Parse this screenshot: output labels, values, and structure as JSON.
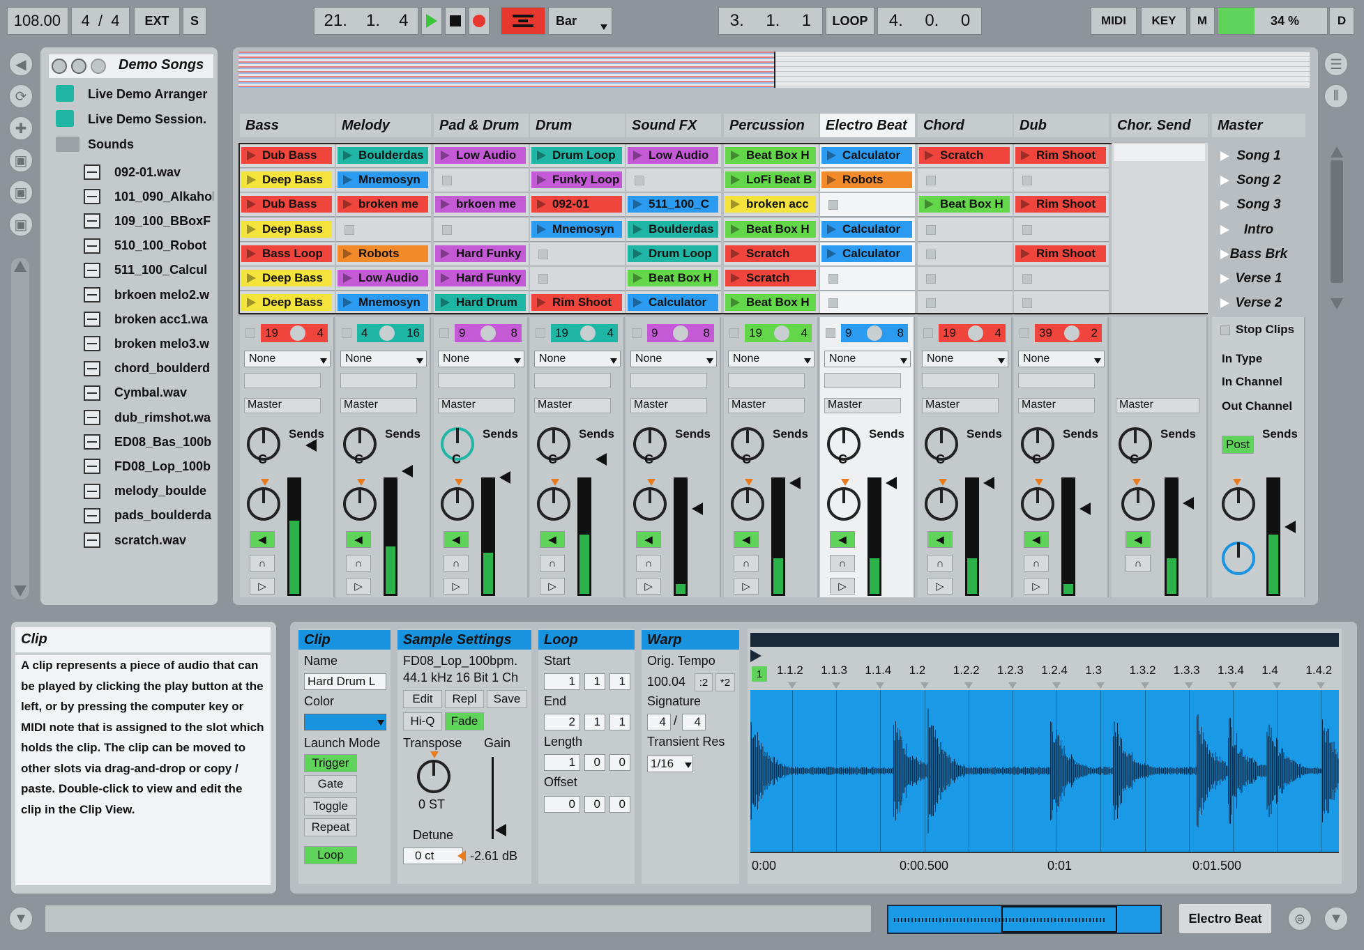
{
  "transport": {
    "tempo": "108.00",
    "sig_num": "4",
    "sig_sep": "/",
    "sig_den": "4",
    "ext": "EXT",
    "s": "S",
    "pos_a": "21.",
    "pos_b": "1.",
    "pos_c": "4",
    "quant": "Bar",
    "loop_start_a": "3.",
    "loop_start_b": "1.",
    "loop_start_c": "1",
    "loop": "LOOP",
    "loop_len_a": "4.",
    "loop_len_b": "0.",
    "loop_len_c": "0",
    "midi": "MIDI",
    "key": "KEY",
    "m": "M",
    "cpu": "34 %",
    "d": "D"
  },
  "browser": {
    "title": "Demo Songs",
    "items": [
      "Live Demo Arranger",
      "Live Demo Session.",
      "Sounds"
    ],
    "files": [
      "092-01.wav",
      "101_090_Alkahol",
      "109_100_BBoxF",
      "510_100_Robot",
      "511_100_Calcul",
      "brkoen melo2.w",
      "broken acc1.wa",
      "broken melo3.w",
      "chord_boulderd",
      "Cymbal.wav",
      "dub_rimshot.wa",
      "ED08_Bas_100b",
      "FD08_Lop_100b",
      "melody_boulde",
      "pads_boulderda",
      "scratch.wav"
    ]
  },
  "tracks": [
    {
      "name": "Bass",
      "clips": [
        [
          "Dub Bass",
          "#f0453d"
        ],
        [
          "Deep Bass",
          "#f4e33a"
        ],
        [
          "Dub Bass",
          "#f0453d"
        ],
        [
          "Deep Bass",
          "#f4e33a"
        ],
        [
          "Bass Loop",
          "#f0453d"
        ],
        [
          "Deep Bass",
          "#f4e33a"
        ],
        [
          "Deep Bass",
          "#f4e33a"
        ]
      ],
      "ctr_a": "19",
      "ctr_b": "4",
      "ctr_color": "#f0453d",
      "input": "None",
      "out": "Master",
      "meter": 0.62
    },
    {
      "name": "Melody",
      "clips": [
        [
          "Boulderdas",
          "#1fb6a6"
        ],
        [
          "Mnemosyn",
          "#2a9bf0"
        ],
        [
          "broken me",
          "#f0453d"
        ],
        null,
        [
          "Robots",
          "#f28a2a"
        ],
        [
          "Low Audio",
          "#c45ad6"
        ],
        [
          "Mnemosyn",
          "#2a9bf0"
        ]
      ],
      "ctr_a": "4",
      "ctr_b": "16",
      "ctr_color": "#1fb6a6",
      "input": "None",
      "out": "Master",
      "meter": 0.4
    },
    {
      "name": "Pad & Drum",
      "clips": [
        [
          "Low Audio",
          "#c45ad6"
        ],
        null,
        [
          "brkoen me",
          "#c45ad6"
        ],
        null,
        [
          "Hard Funky",
          "#c45ad6"
        ],
        [
          "Hard Funky",
          "#c45ad6"
        ],
        [
          "Hard Drum",
          "#1fb6a6"
        ]
      ],
      "ctr_a": "9",
      "ctr_b": "8",
      "ctr_color": "#c45ad6",
      "input": "None",
      "out": "Master",
      "meter": 0.35
    },
    {
      "name": "Drum",
      "clips": [
        [
          "Drum Loop",
          "#1fb6a6"
        ],
        [
          "Funky Loop",
          "#c45ad6"
        ],
        [
          "092-01",
          "#f0453d"
        ],
        [
          "Mnemosyn",
          "#2a9bf0"
        ],
        null,
        null,
        [
          "Rim Shoot",
          "#f0453d"
        ]
      ],
      "ctr_a": "19",
      "ctr_b": "4",
      "ctr_color": "#1fb6a6",
      "input": "None",
      "out": "Master",
      "meter": 0.5
    },
    {
      "name": "Sound FX",
      "clips": [
        [
          "Low Audio",
          "#c45ad6"
        ],
        null,
        [
          "511_100_C",
          "#2a9bf0"
        ],
        [
          "Boulderdas",
          "#1fb6a6"
        ],
        [
          "Drum Loop",
          "#1fb6a6"
        ],
        [
          "Beat Box H",
          "#63d64a"
        ],
        [
          "Calculator",
          "#2a9bf0"
        ]
      ],
      "ctr_a": "9",
      "ctr_b": "8",
      "ctr_color": "#c45ad6",
      "input": "None",
      "out": "Master",
      "meter": 0.08
    },
    {
      "name": "Percussion",
      "clips": [
        [
          "Beat Box H",
          "#63d64a"
        ],
        [
          "LoFi Beat B",
          "#63d64a"
        ],
        [
          "broken acc",
          "#f4e33a"
        ],
        [
          "Beat Box H",
          "#63d64a"
        ],
        [
          "Scratch",
          "#f0453d"
        ],
        [
          "Scratch",
          "#f0453d"
        ],
        [
          "Beat Box H",
          "#63d64a"
        ]
      ],
      "ctr_a": "19",
      "ctr_b": "4",
      "ctr_color": "#63d64a",
      "input": "None",
      "out": "Master",
      "meter": 0.3
    },
    {
      "name": "Electro Beat",
      "clips": [
        [
          "Calculator",
          "#2a9bf0"
        ],
        [
          "Robots",
          "#f28a2a"
        ],
        null,
        [
          "Calculator",
          "#2a9bf0"
        ],
        [
          "Calculator",
          "#2a9bf0"
        ],
        null,
        null
      ],
      "ctr_a": "9",
      "ctr_b": "8",
      "ctr_color": "#2a9bf0",
      "input": "None",
      "out": "Master",
      "meter": 0.3
    },
    {
      "name": "Chord",
      "clips": [
        [
          "Scratch",
          "#f0453d"
        ],
        null,
        [
          "Beat Box H",
          "#63d64a"
        ],
        null,
        null,
        null,
        null
      ],
      "ctr_a": "19",
      "ctr_b": "4",
      "ctr_color": "#f0453d",
      "input": "None",
      "out": "Master",
      "meter": 0.3
    },
    {
      "name": "Dub",
      "clips": [
        [
          "Rim Shoot",
          "#f0453d"
        ],
        null,
        [
          "Rim Shoot",
          "#f0453d"
        ],
        null,
        [
          "Rim Shoot",
          "#f0453d"
        ],
        null,
        null
      ],
      "ctr_a": "39",
      "ctr_b": "2",
      "ctr_color": "#f0453d",
      "input": "None",
      "out": "Master",
      "meter": 0.08
    }
  ],
  "return_track": {
    "name": "Chor. Send",
    "out": "Master",
    "sends": "Sends"
  },
  "master": {
    "name": "Master",
    "scenes": [
      "Song 1",
      "Song 2",
      "Song 3",
      "Intro",
      "Bass Brk",
      "Verse 1",
      "Verse 2"
    ],
    "stop_clips": "Stop Clips",
    "in_type": "In Type",
    "in_channel": "In Channel",
    "out_channel": "Out Channel",
    "post": "Post",
    "sends": "Sends"
  },
  "sends_label": "Sends",
  "knob_letter": "C",
  "info": {
    "title": "Clip",
    "text": "A clip represents a piece of audio that can be played by clicking the play button at the left, or by pressing the computer key or MIDI note that is assigned to the slot which holds the clip. The clip can be moved to other slots via drag-and-drop or copy / paste. Double-click to view and edit the clip in the Clip View."
  },
  "clip": {
    "title": "Clip",
    "name_label": "Name",
    "name": "Hard Drum L",
    "color_label": "Color",
    "launch_label": "Launch Mode",
    "trigger": "Trigger",
    "gate": "Gate",
    "toggle": "Toggle",
    "repeat": "Repeat",
    "loop": "Loop",
    "accent": "#1893e0"
  },
  "sample": {
    "title": "Sample Settings",
    "file": "FD08_Lop_100bpm.",
    "format": "44.1 kHz 16 Bit 1 Ch",
    "edit": "Edit",
    "repl": "Repl",
    "save": "Save",
    "hiq": "Hi-Q",
    "fade": "Fade",
    "transpose_label": "Transpose",
    "gain_label": "Gain",
    "transpose": "0 ST",
    "detune_label": "Detune",
    "detune": "0 ct",
    "gain": "-2.61 dB"
  },
  "loop": {
    "title": "Loop",
    "start_label": "Start",
    "start": [
      "1",
      "1",
      "1"
    ],
    "end_label": "End",
    "end": [
      "2",
      "1",
      "1"
    ],
    "length_label": "Length",
    "length": [
      "1",
      "0",
      "0"
    ],
    "offset_label": "Offset",
    "offset": [
      "0",
      "0",
      "0"
    ]
  },
  "warp": {
    "title": "Warp",
    "tempo_label": "Orig. Tempo",
    "tempo": "100.04",
    "half": ":2",
    "double": "*2",
    "sig_label": "Signature",
    "sig_num": "4",
    "sig_den": "4",
    "transient_label": "Transient Res",
    "transient": "1/16"
  },
  "waveform": {
    "marker": "1",
    "ticks": [
      "1.1.2",
      "1.1.3",
      "1.1.4",
      "1.2",
      "1.2.2",
      "1.2.3",
      "1.2.4",
      "1.3",
      "1.3.2",
      "1.3.3",
      "1.3.4",
      "1.4",
      "1.4.2"
    ],
    "times": [
      "0:00",
      "0:00.500",
      "0:01",
      "0:01.500"
    ],
    "color": "#1a9ae6"
  },
  "status": {
    "track": "Electro Beat"
  }
}
